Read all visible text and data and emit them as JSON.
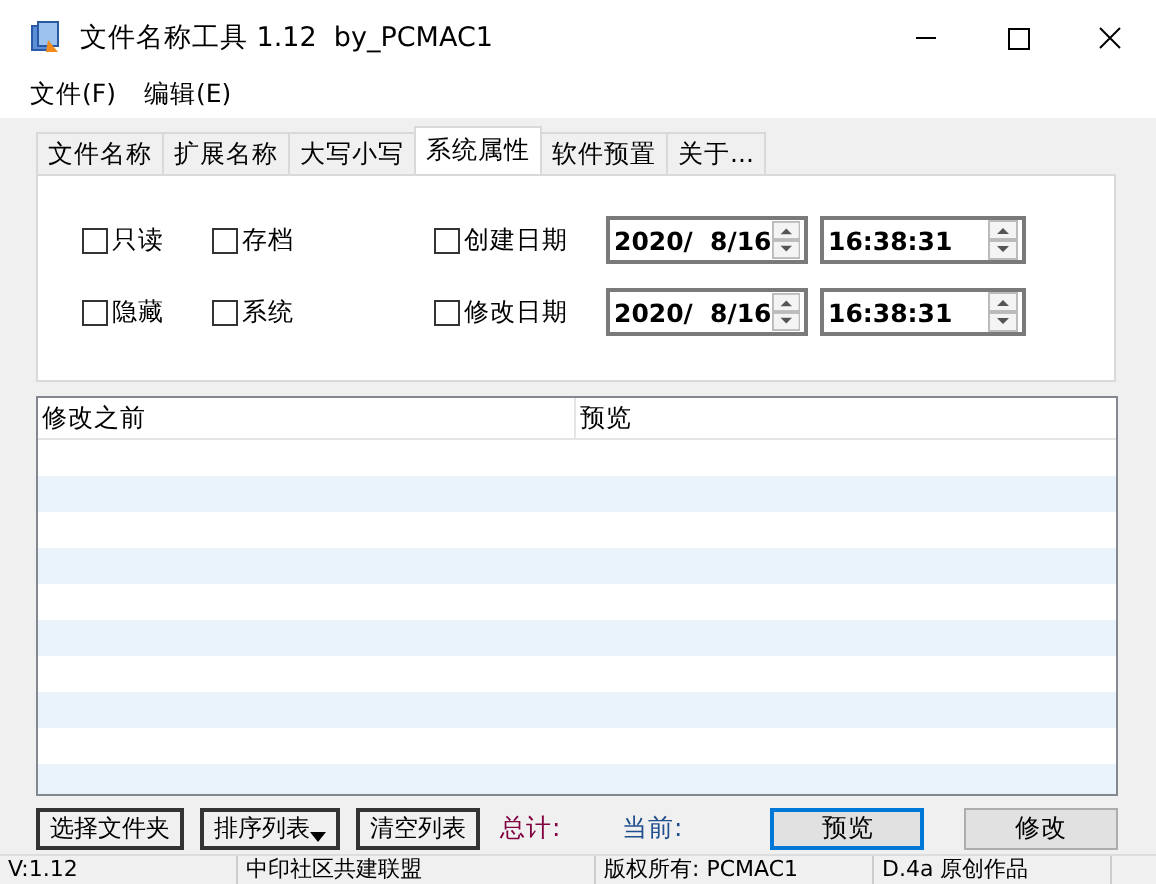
{
  "window": {
    "title": "文件名称工具 1.12  by_PCMAC1"
  },
  "menu": [
    {
      "label": "文件(F)"
    },
    {
      "label": "编辑(E)"
    }
  ],
  "tabs": [
    {
      "label": "文件名称",
      "selected": false
    },
    {
      "label": "扩展名称",
      "selected": false
    },
    {
      "label": "大写小写",
      "selected": false
    },
    {
      "label": "系统属性",
      "selected": true
    },
    {
      "label": "软件预置",
      "selected": false
    },
    {
      "label": "关于...",
      "selected": false
    }
  ],
  "attributes": [
    {
      "label": "只读",
      "checked": false
    },
    {
      "label": "存档",
      "checked": false
    },
    {
      "label": "隐藏",
      "checked": false
    },
    {
      "label": "系统",
      "checked": false
    }
  ],
  "dates": [
    {
      "label": "创建日期",
      "checked": false,
      "date": "2020/  8/16",
      "time": "16:38:31"
    },
    {
      "label": "修改日期",
      "checked": false,
      "date": "2020/  8/16",
      "time": "16:38:31"
    }
  ],
  "table": {
    "columns": [
      "修改之前",
      "预览"
    ]
  },
  "buttons": [
    {
      "label": "选择文件夹",
      "kind": "plain"
    },
    {
      "label": "排序列表",
      "kind": "dropdown"
    },
    {
      "label": "清空列表",
      "kind": "plain"
    }
  ],
  "counters": [
    {
      "label": "总计:",
      "color": "#800040"
    },
    {
      "label": "当前:",
      "color": "#1f4e8c"
    }
  ],
  "actions": [
    {
      "label": "预览",
      "selected": true
    },
    {
      "label": "修改",
      "selected": false
    }
  ],
  "status_bar": [
    "V:1.12",
    "中印社区共建联盟",
    "版权所有: PCMAC1",
    "D.4a 原创作品"
  ]
}
